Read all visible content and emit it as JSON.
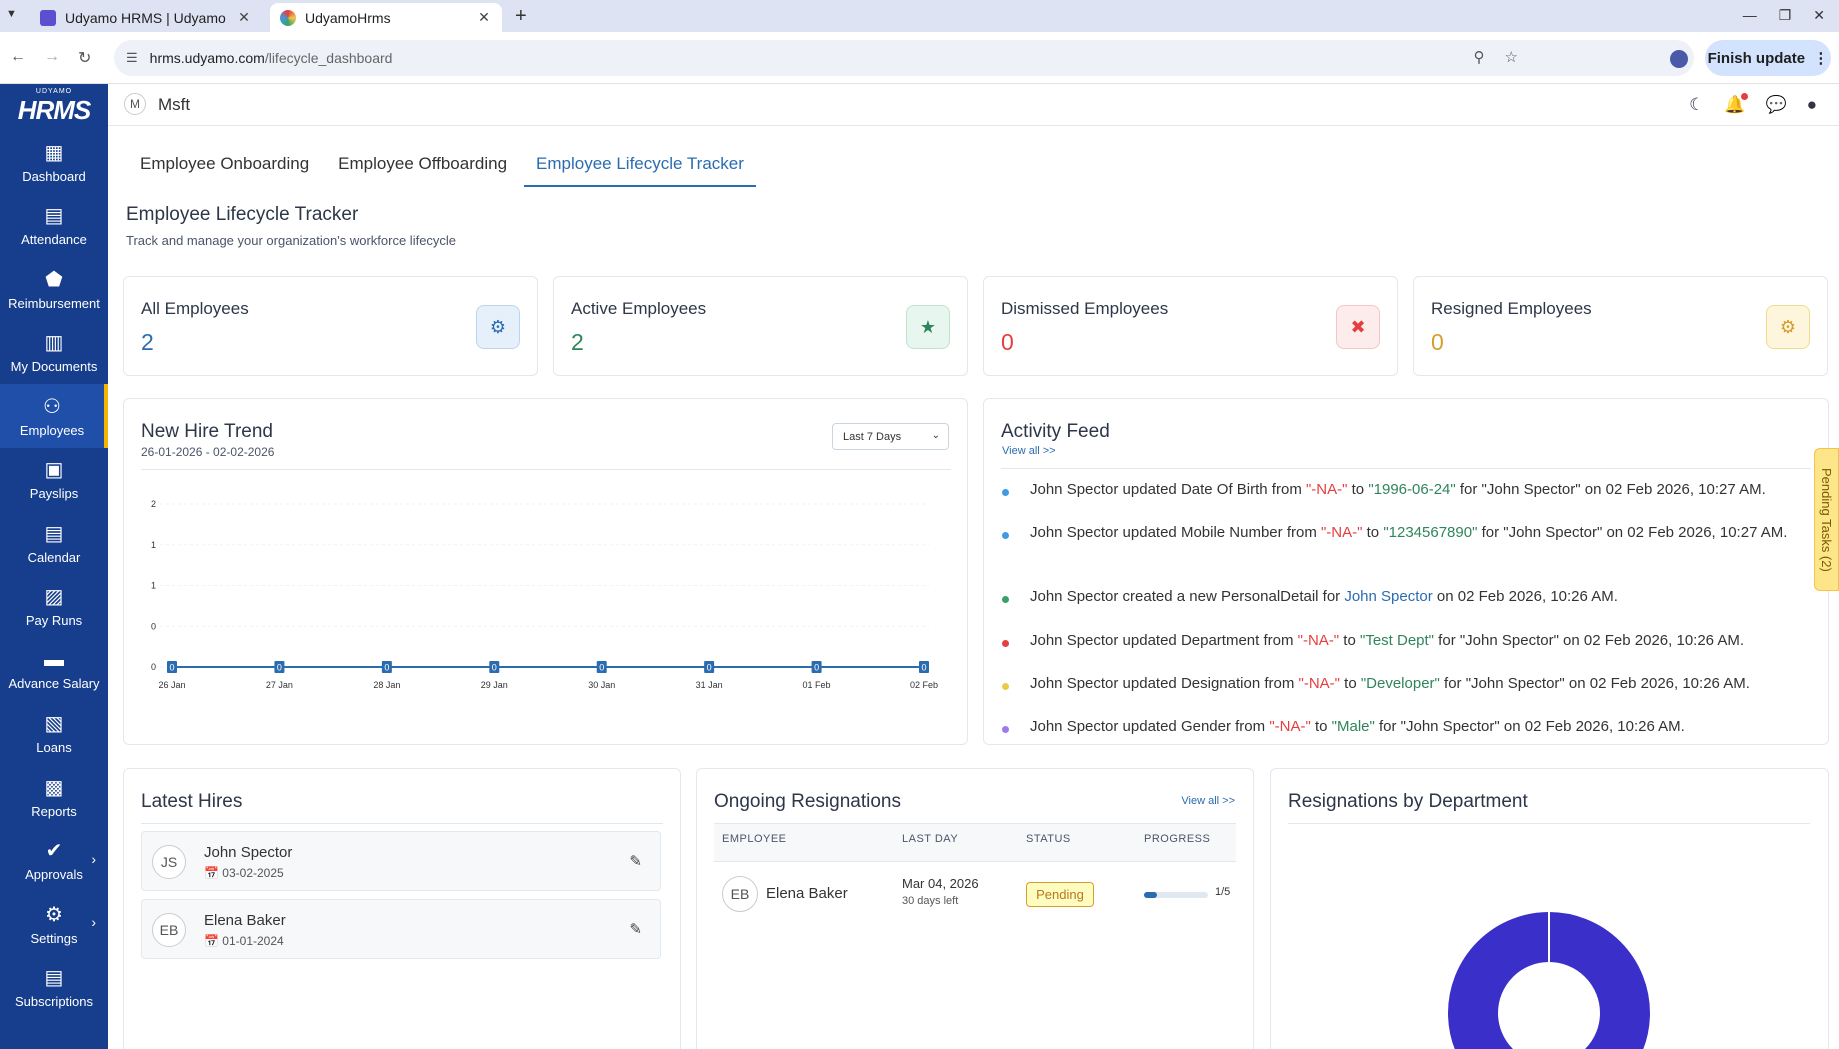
{
  "browser": {
    "tabs": [
      {
        "title": "Udyamo HRMS | Udyamo",
        "active": false
      },
      {
        "title": "UdyamoHrms",
        "active": true
      }
    ],
    "url_host": "hrms.udyamo.com",
    "url_path": "/lifecycle_dashboard",
    "finish_update": "Finish update"
  },
  "sidebar": {
    "logo_small": "UDYAMO",
    "logo_big": "HRMS",
    "items": [
      {
        "label": "Dashboard",
        "icon": "dashboard-icon"
      },
      {
        "label": "Attendance",
        "icon": "calendar-icon"
      },
      {
        "label": "Reimbursement",
        "icon": "tag-icon"
      },
      {
        "label": "My Documents",
        "icon": "document-icon"
      },
      {
        "label": "Employees",
        "icon": "people-icon",
        "active": true
      },
      {
        "label": "Payslips",
        "icon": "payslip-icon"
      },
      {
        "label": "Calendar",
        "icon": "calendar-icon"
      },
      {
        "label": "Pay Runs",
        "icon": "payrun-icon"
      },
      {
        "label": "Advance Salary",
        "icon": "card-icon"
      },
      {
        "label": "Loans",
        "icon": "loan-icon"
      },
      {
        "label": "Reports",
        "icon": "chart-icon"
      },
      {
        "label": "Approvals",
        "icon": "check-icon"
      },
      {
        "label": "Settings",
        "icon": "gear-icon"
      },
      {
        "label": "Subscriptions",
        "icon": "subscription-icon"
      }
    ]
  },
  "header": {
    "org_initial": "M",
    "org_name": "Msft"
  },
  "tabs": [
    "Employee Onboarding",
    "Employee Offboarding",
    "Employee Lifecycle Tracker"
  ],
  "page": {
    "title": "Employee Lifecycle Tracker",
    "subtitle": "Track and manage your organization's workforce lifecycle"
  },
  "stats": [
    {
      "label": "All Employees",
      "value": "2",
      "color": "#2b6cb0",
      "bg": "#e6f0fb",
      "border": "#bcd4f3"
    },
    {
      "label": "Active Employees",
      "value": "2",
      "color": "#2f855a",
      "bg": "#e7f6ee",
      "border": "#bfe3cf"
    },
    {
      "label": "Dismissed Employees",
      "value": "0",
      "color": "#e53e3e",
      "bg": "#fdecec",
      "border": "#f5c6c6"
    },
    {
      "label": "Resigned Employees",
      "value": "0",
      "color": "#d69e2e",
      "bg": "#fdf6dc",
      "border": "#f1dc8e"
    }
  ],
  "new_hire_trend": {
    "title": "New Hire Trend",
    "range": "26-01-2026 - 02-02-2026",
    "dropdown": "Last 7 Days"
  },
  "chart_data": {
    "type": "line",
    "categories": [
      "26 Jan",
      "27 Jan",
      "28 Jan",
      "29 Jan",
      "30 Jan",
      "31 Jan",
      "01 Feb",
      "02 Feb"
    ],
    "values": [
      0,
      0,
      0,
      0,
      0,
      0,
      0,
      0
    ],
    "data_labels": [
      "0",
      "0",
      "0",
      "0",
      "0",
      "0",
      "0",
      "0"
    ],
    "ytick_labels": [
      "2",
      "1",
      "1",
      "0",
      "0"
    ],
    "ylim": [
      0,
      2
    ],
    "grid": true,
    "color": "#2b6cb0"
  },
  "activity_feed": {
    "title": "Activity Feed",
    "view_all": "View all >>",
    "items": [
      {
        "color": "#4299e1",
        "parts": [
          [
            "John Spector updated Date Of Birth from ",
            ""
          ],
          [
            "\"-NA-\"",
            "red"
          ],
          [
            " to ",
            ""
          ],
          [
            "\"1996-06-24\"",
            "green"
          ],
          [
            " for \"John Spector\" on 02 Feb 2026, 10:27 AM.",
            ""
          ]
        ]
      },
      {
        "color": "#4299e1",
        "parts": [
          [
            "John Spector updated Mobile Number from ",
            ""
          ],
          [
            "\"-NA-\"",
            "red"
          ],
          [
            " to ",
            ""
          ],
          [
            "\"1234567890\"",
            "green"
          ],
          [
            " for \"John Spector\" on 02 Feb 2026, 10:27 AM.",
            ""
          ]
        ]
      },
      {
        "color": "#38a169",
        "parts": [
          [
            "John Spector created a new PersonalDetail for ",
            ""
          ],
          [
            "John Spector",
            "blue"
          ],
          [
            " on 02 Feb 2026, 10:26 AM.",
            ""
          ]
        ]
      },
      {
        "color": "#e53e3e",
        "parts": [
          [
            "John Spector updated Department from ",
            ""
          ],
          [
            "\"-NA-\"",
            "red"
          ],
          [
            " to ",
            ""
          ],
          [
            "\"Test Dept\"",
            "green"
          ],
          [
            " for \"John Spector\" on 02 Feb 2026, 10:26 AM.",
            ""
          ]
        ]
      },
      {
        "color": "#ecc94b",
        "parts": [
          [
            "John Spector updated Designation from ",
            ""
          ],
          [
            "\"-NA-\"",
            "red"
          ],
          [
            " to ",
            ""
          ],
          [
            "\"Developer\"",
            "green"
          ],
          [
            " for \"John Spector\" on 02 Feb 2026, 10:26 AM.",
            ""
          ]
        ]
      },
      {
        "color": "#9f7aea",
        "parts": [
          [
            "John Spector updated Gender from ",
            ""
          ],
          [
            "\"-NA-\"",
            "red"
          ],
          [
            " to ",
            ""
          ],
          [
            "\"Male\"",
            "green"
          ],
          [
            " for \"John Spector\" on 02 Feb 2026, 10:26 AM.",
            ""
          ]
        ]
      }
    ]
  },
  "pending_tasks": "Pending Tasks (2)",
  "latest_hires": {
    "title": "Latest Hires",
    "items": [
      {
        "initials": "JS",
        "name": "John Spector",
        "date": "03-02-2025"
      },
      {
        "initials": "EB",
        "name": "Elena Baker",
        "date": "01-01-2024"
      }
    ]
  },
  "ongoing_resignations": {
    "title": "Ongoing Resignations",
    "view_all": "View all >>",
    "columns": [
      "EMPLOYEE",
      "LAST DAY",
      "STATUS",
      "PROGRESS"
    ],
    "rows": [
      {
        "initials": "EB",
        "name": "Elena Baker",
        "last_day": "Mar 04, 2026",
        "days_left": "30 days left",
        "status": "Pending",
        "progress_text": "1/5",
        "progress_fraction": 0.2
      }
    ]
  },
  "resignations_by_department": {
    "title": "Resignations by Department",
    "color": "#3b2fc9"
  }
}
